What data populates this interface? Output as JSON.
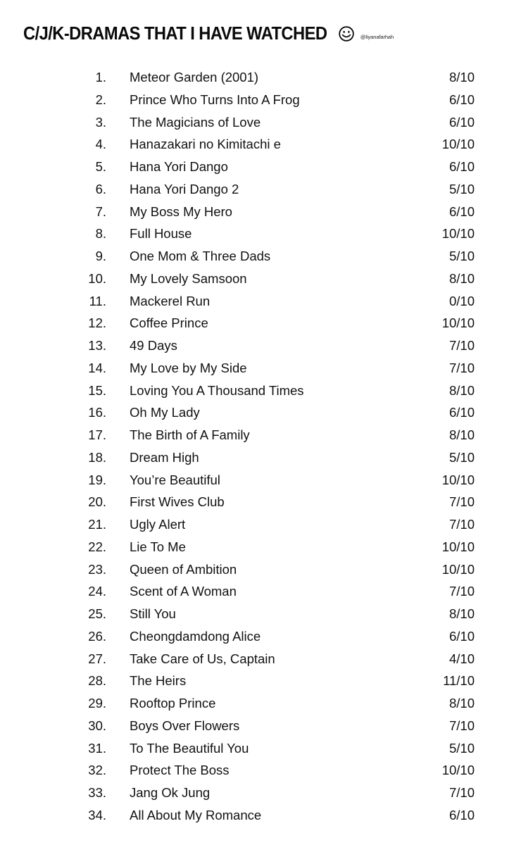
{
  "header": {
    "title": "C/J/K-DRAMAS THAT I HAVE WATCHED",
    "emoji_icon": "smiley-face-icon",
    "handle": "@liyanafarhah"
  },
  "dramas": [
    {
      "number": "1.",
      "title": "Meteor Garden (2001)",
      "rating": "8/10"
    },
    {
      "number": "2.",
      "title": "Prince Who Turns Into A Frog",
      "rating": "6/10"
    },
    {
      "number": "3.",
      "title": "The Magicians of Love",
      "rating": "6/10"
    },
    {
      "number": "4.",
      "title": "Hanazakari no Kimitachi e",
      "rating": "10/10"
    },
    {
      "number": "5.",
      "title": "Hana Yori Dango",
      "rating": "6/10"
    },
    {
      "number": "6.",
      "title": "Hana Yori Dango 2",
      "rating": "5/10"
    },
    {
      "number": "7.",
      "title": "My Boss My Hero",
      "rating": "6/10"
    },
    {
      "number": "8.",
      "title": "Full House",
      "rating": "10/10"
    },
    {
      "number": "9.",
      "title": "One Mom & Three Dads",
      "rating": "5/10"
    },
    {
      "number": "10.",
      "title": "My Lovely Samsoon",
      "rating": "8/10"
    },
    {
      "number": "11.",
      "title": "Mackerel Run",
      "rating": "0/10"
    },
    {
      "number": "12.",
      "title": "Coffee Prince",
      "rating": "10/10"
    },
    {
      "number": "13.",
      "title": "49 Days",
      "rating": "7/10"
    },
    {
      "number": "14.",
      "title": "My Love by My Side",
      "rating": "7/10"
    },
    {
      "number": "15.",
      "title": "Loving You A Thousand Times",
      "rating": "8/10"
    },
    {
      "number": "16.",
      "title": "Oh My Lady",
      "rating": "6/10"
    },
    {
      "number": "17.",
      "title": "The Birth of A Family",
      "rating": "8/10"
    },
    {
      "number": "18.",
      "title": "Dream High",
      "rating": "5/10"
    },
    {
      "number": "19.",
      "title": "You’re Beautiful",
      "rating": "10/10"
    },
    {
      "number": "20.",
      "title": "First Wives Club",
      "rating": "7/10"
    },
    {
      "number": "21.",
      "title": "Ugly Alert",
      "rating": "7/10"
    },
    {
      "number": "22.",
      "title": "Lie To Me",
      "rating": "10/10"
    },
    {
      "number": "23.",
      "title": "Queen of Ambition",
      "rating": "10/10"
    },
    {
      "number": "24.",
      "title": "Scent of A Woman",
      "rating": "7/10"
    },
    {
      "number": "25.",
      "title": "Still You",
      "rating": "8/10"
    },
    {
      "number": "26.",
      "title": "Cheongdamdong Alice",
      "rating": "6/10"
    },
    {
      "number": "27.",
      "title": "Take Care of Us, Captain",
      "rating": "4/10"
    },
    {
      "number": "28.",
      "title": "The Heirs",
      "rating": "11/10"
    },
    {
      "number": "29.",
      "title": "Rooftop Prince",
      "rating": "8/10"
    },
    {
      "number": "30.",
      "title": "Boys Over Flowers",
      "rating": "7/10"
    },
    {
      "number": "31.",
      "title": "To The Beautiful You",
      "rating": "5/10"
    },
    {
      "number": "32.",
      "title": "Protect The Boss",
      "rating": "10/10"
    },
    {
      "number": "33.",
      "title": "Jang Ok Jung",
      "rating": "7/10"
    },
    {
      "number": "34.",
      "title": "All About My Romance",
      "rating": "6/10"
    }
  ]
}
